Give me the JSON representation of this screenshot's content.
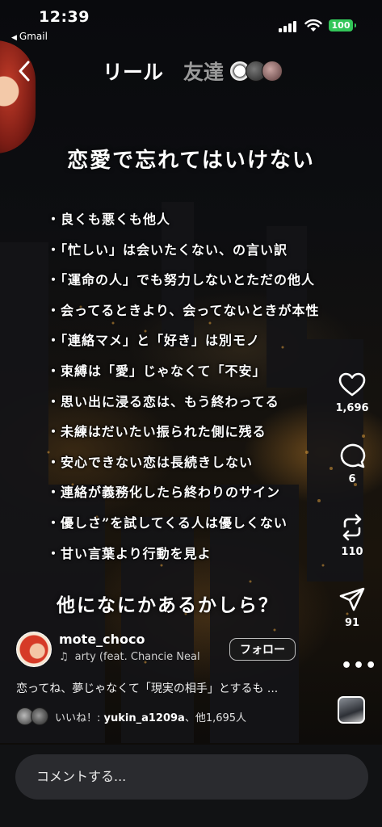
{
  "status_bar": {
    "time": "12:39",
    "back_app": "Gmail",
    "battery": "100",
    "battery_color": "#33c659"
  },
  "header": {
    "back_icon": "chevron-left-icon",
    "title": "リール",
    "friends_tab": "友達"
  },
  "reel": {
    "headline": "恋愛で忘れてはいけない",
    "points": [
      "・良くも悪くも他人",
      "・「忙しい」は会いたくない、の言い訳",
      "・「運命の人」でも努力しないとただの他人",
      "・会ってるときより、会ってないときが本性",
      "・「連絡マメ」と「好き」は別モノ",
      "・束縛は「愛」じゃなくて「不安」",
      "・思い出に浸る恋は、もう終わってる",
      "・未練はだいたい振られた側に残る",
      "・安心できない恋は長続きしない",
      "・連絡が義務化したら終わりのサイン",
      "・優しさ”を試してくる人は優しくない",
      "・甘い言葉より行動を見よ"
    ],
    "closing": "他になにかあるかしら？"
  },
  "actions": {
    "likes": "1,696",
    "comments": "6",
    "reposts": "110",
    "shares": "91",
    "more": "•••"
  },
  "post": {
    "username": "mote_choco",
    "music": "arty (feat. Chancie Neal",
    "follow_label": "フォロー",
    "caption": "恋ってね、夢じゃなくて「現実の相手」とするも ...",
    "likes_prefix": "いいね！: ",
    "likes_user": "yukin_a1209a",
    "likes_suffix": "、他1,695人"
  },
  "comment_bar": {
    "placeholder": "コメントする..."
  }
}
